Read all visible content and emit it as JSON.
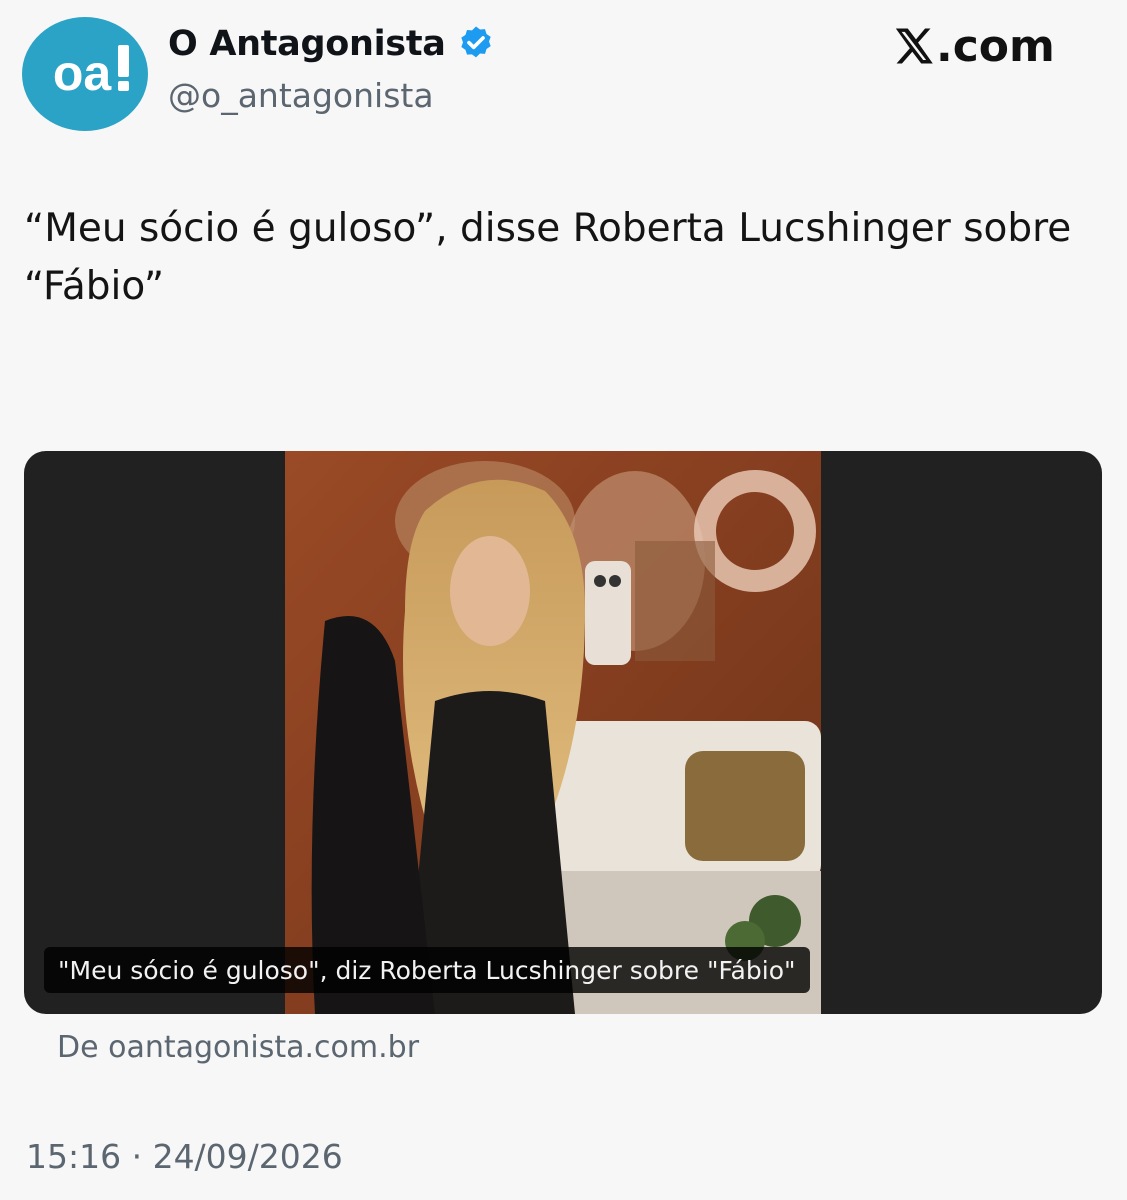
{
  "author": {
    "display_name": "O Antagonista",
    "handle": "@o_antagonista",
    "avatar_logo_text": "oa!",
    "avatar_color": "#2aa3c6",
    "verified": true,
    "verified_color": "#1d9bf0"
  },
  "brand": {
    "domain_suffix": ".com",
    "logo_icon": "x-logo-icon"
  },
  "tweet": {
    "text": "“Meu sócio é guloso”, disse Roberta Lucshinger sobre “Fábio”",
    "timestamp": "15:16 · 24/09/2026"
  },
  "card": {
    "caption": "\"Meu sócio é guloso\", diz Roberta Lucshinger sobre \"Fábio\"",
    "source": "De oantagonista.com.br",
    "background_color": "#212121"
  },
  "colors": {
    "page_background": "#f7f7f7",
    "secondary_text": "#5b6670"
  }
}
